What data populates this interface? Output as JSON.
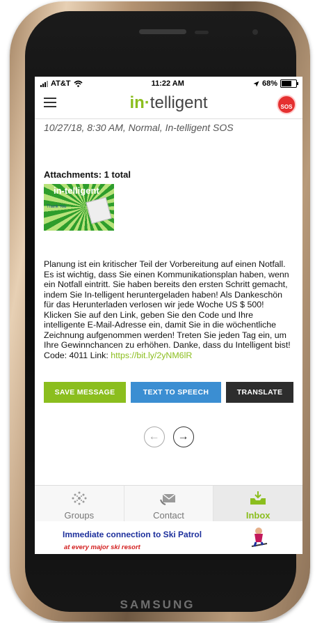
{
  "device": {
    "brand": "SAMSUNG"
  },
  "status_bar": {
    "carrier": "AT&T",
    "time": "11:22 AM",
    "battery": "68%",
    "battery_level": 0.68
  },
  "header": {
    "logo_prefix": "in",
    "logo_dot": "·",
    "logo_suffix": "telligent",
    "sos_label": "SOS"
  },
  "message": {
    "meta": "10/27/18, 8:30 AM, Normal, In-telligent SOS",
    "attachments_title": "Attachments: 1 total",
    "thumbnail_text": "in-telligent",
    "thumbnail_subtext": "Thank You",
    "body": "Planung ist ein kritischer Teil der Vorbereitung auf einen Notfall. Es ist wichtig, dass Sie einen Kommunikationsplan haben, wenn ein Notfall eintritt. Sie haben bereits den ersten Schritt gemacht, indem Sie In-telligent heruntergeladen haben! Als Dankeschön für das Herunterladen verlosen wir jede Woche US $ 500! Klicken Sie auf den Link, geben Sie den Code und Ihre intelligente E-Mail-Adresse ein, damit Sie in die wöchentliche Zeichnung aufgenommen werden! Treten Sie jeden Tag ein, um Ihre Gewinnchancen zu erhöhen. Danke, dass du Intelligent bist! Code: 4011 Link: ",
    "link": "https://bit.ly/2yNM6lR"
  },
  "actions": {
    "save": "SAVE MESSAGE",
    "tts": "TEXT TO SPEECH",
    "translate": "TRANSLATE"
  },
  "pager": {
    "prev": "←",
    "next": "→"
  },
  "tabs": [
    {
      "label": "Groups",
      "icon": "groups-icon"
    },
    {
      "label": "Contact",
      "icon": "contact-icon"
    },
    {
      "label": "Inbox",
      "icon": "inbox-icon",
      "active": true
    }
  ],
  "ad": {
    "line1": "Immediate connection to Ski Patrol",
    "line2": "at every major ski resort"
  },
  "colors": {
    "brand_green": "#8bbe1e",
    "tts_blue": "#3b8ed2",
    "translate_dark": "#2d2d2d",
    "sos_red": "#e53030"
  }
}
